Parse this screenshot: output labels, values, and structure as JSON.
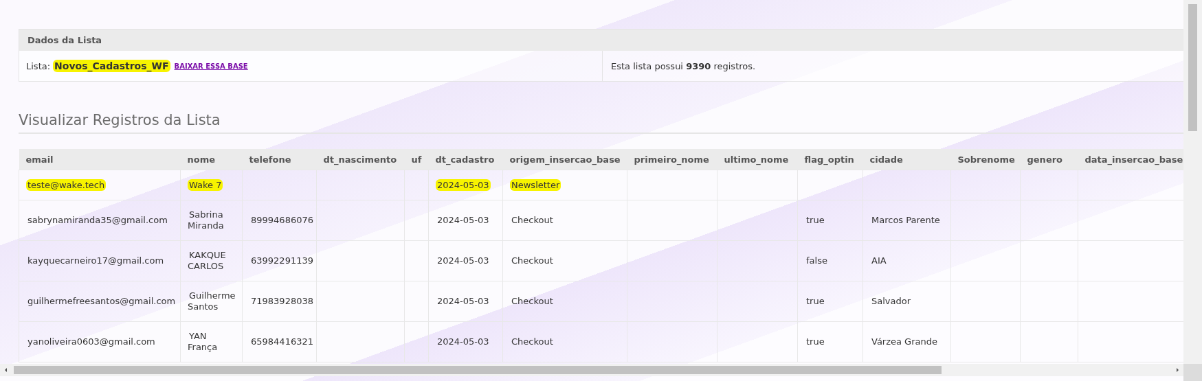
{
  "list_panel": {
    "title": "Dados da Lista",
    "label": "Lista:",
    "list_name": "Novos_Cadastros_WF",
    "list_name_highlighted": true,
    "download_link": "BAIXAR ESSA BASE",
    "summary": "Esta lista possui **9390** registros."
  },
  "records": {
    "title": "Visualizar Registros da Lista",
    "columns": [
      "email",
      "nome",
      "telefone",
      "dt_nascimento",
      "uf",
      "dt_cadastro",
      "origem_insercao_base",
      "primeiro_nome",
      "ultimo_nome",
      "flag_optin",
      "cidade",
      "Sobrenome",
      "genero",
      "data_insercao_base"
    ],
    "rows": [
      {
        "highlighted": true,
        "cells": [
          "teste@wake.tech",
          "Wake 7",
          null,
          null,
          null,
          "2024-05-03",
          "Newsletter",
          null,
          null,
          null,
          null,
          null,
          null,
          null
        ]
      },
      {
        "highlighted": false,
        "cells": [
          "sabrynamiranda35@gmail.com",
          "Sabrina Miranda",
          "89994686076",
          null,
          null,
          "2024-05-03",
          "Checkout",
          null,
          null,
          "true",
          "Marcos Parente",
          null,
          null,
          null
        ]
      },
      {
        "highlighted": false,
        "cells": [
          "kayquecarneiro17@gmail.com",
          "KAKQUE CARLOS",
          "63992291139",
          null,
          null,
          "2024-05-03",
          "Checkout",
          null,
          null,
          "false",
          "AIA",
          null,
          null,
          null
        ]
      },
      {
        "highlighted": false,
        "cells": [
          "guilhermefreesantos@gmail.com",
          "Guilherme Santos",
          "71983928038",
          null,
          null,
          "2024-05-03",
          "Checkout",
          null,
          null,
          "true",
          "Salvador",
          null,
          null,
          null
        ]
      },
      {
        "highlighted": false,
        "cells": [
          "yanoliveira0603@gmail.com",
          "YAN França",
          "65984416321",
          null,
          null,
          "2024-05-03",
          "Checkout",
          null,
          null,
          "true",
          "Várzea Grande",
          null,
          null,
          null
        ]
      }
    ]
  }
}
